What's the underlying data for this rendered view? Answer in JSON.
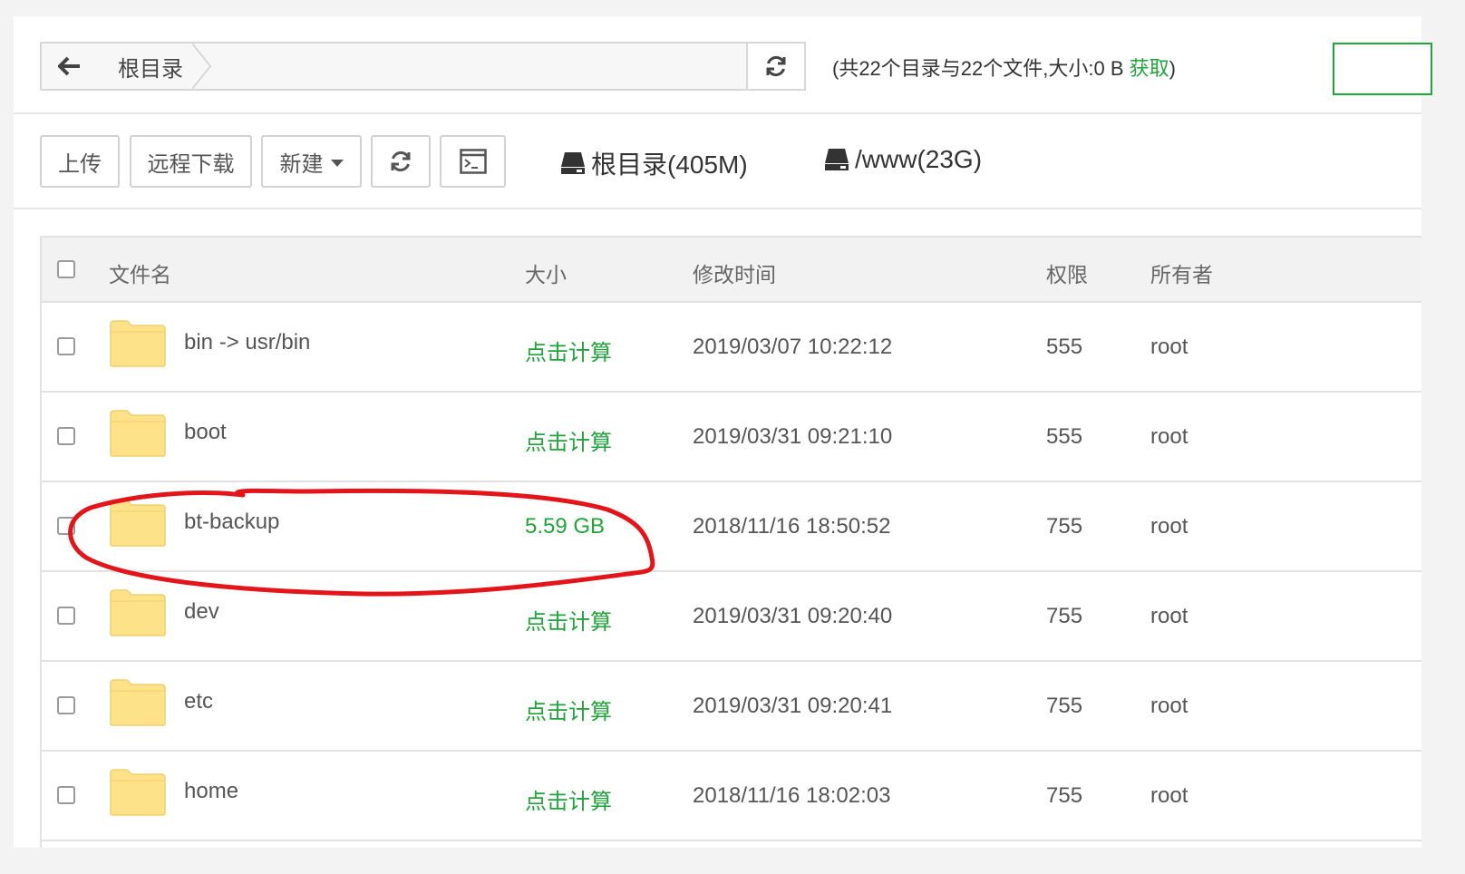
{
  "pathbar": {
    "crumb": "根目录",
    "summary_prefix": "(共22个目录与22个文件,大小:0 B ",
    "summary_link": "获取",
    "summary_suffix": ")"
  },
  "toolbar": {
    "upload": "上传",
    "remote_download": "远程下载",
    "new": "新建",
    "disks": [
      {
        "label": "根目录(405M)"
      },
      {
        "label": "/www(23G)"
      }
    ]
  },
  "table": {
    "headers": {
      "name": "文件名",
      "size": "大小",
      "mtime": "修改时间",
      "perm": "权限",
      "owner": "所有者"
    },
    "rows": [
      {
        "name": "bin -> usr/bin",
        "size": "点击计算",
        "mtime": "2019/03/07 10:22:12",
        "perm": "555",
        "owner": "root"
      },
      {
        "name": "boot",
        "size": "点击计算",
        "mtime": "2019/03/31 09:21:10",
        "perm": "555",
        "owner": "root"
      },
      {
        "name": "bt-backup",
        "size": "5.59 GB",
        "mtime": "2018/11/16 18:50:52",
        "perm": "755",
        "owner": "root"
      },
      {
        "name": "dev",
        "size": "点击计算",
        "mtime": "2019/03/31 09:20:40",
        "perm": "755",
        "owner": "root"
      },
      {
        "name": "etc",
        "size": "点击计算",
        "mtime": "2019/03/31 09:20:41",
        "perm": "755",
        "owner": "root"
      },
      {
        "name": "home",
        "size": "点击计算",
        "mtime": "2018/11/16 18:02:03",
        "perm": "755",
        "owner": "root"
      }
    ]
  },
  "colors": {
    "accent": "#20a53a",
    "folder": "#fde28a",
    "annotation": "#e3151b"
  }
}
